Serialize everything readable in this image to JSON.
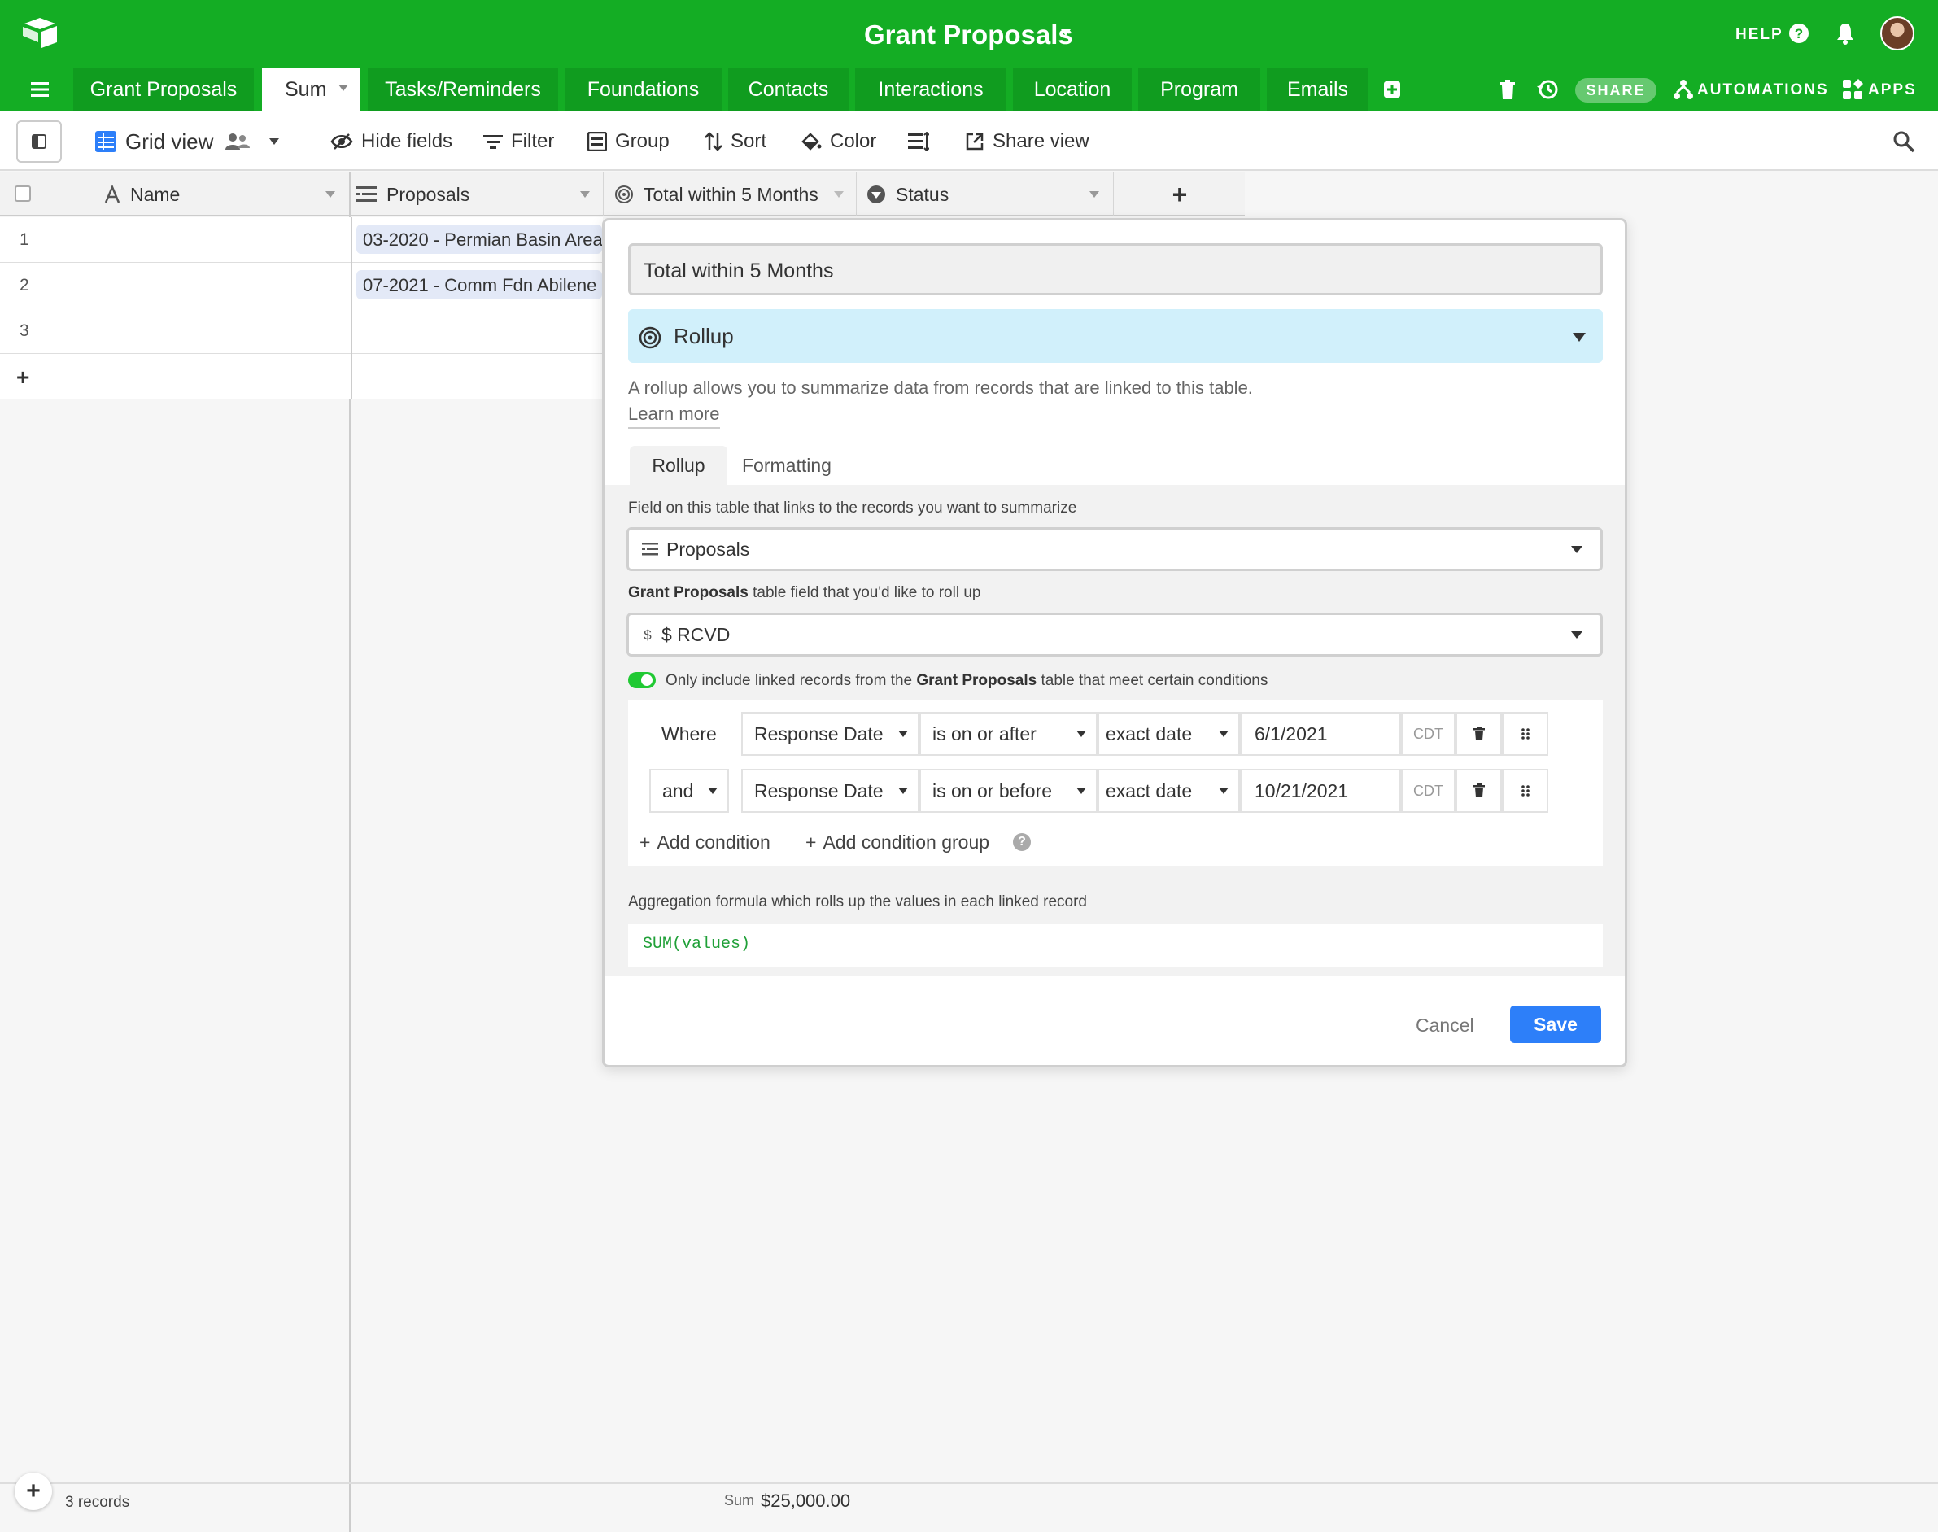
{
  "app": {
    "base_title": "Grant Proposals",
    "help_label": "HELP",
    "share_label": "SHARE",
    "automations_label": "AUTOMATIONS",
    "apps_label": "APPS",
    "accent_color": "#14ad24"
  },
  "tabs": [
    {
      "label": "Grant Proposals",
      "active": false
    },
    {
      "label": "Sum",
      "active": true
    },
    {
      "label": "Tasks/Reminders",
      "active": false
    },
    {
      "label": "Foundations",
      "active": false
    },
    {
      "label": "Contacts",
      "active": false
    },
    {
      "label": "Interactions",
      "active": false
    },
    {
      "label": "Location",
      "active": false
    },
    {
      "label": "Program",
      "active": false
    },
    {
      "label": "Emails",
      "active": false
    }
  ],
  "toolbar": {
    "view_name": "Grid view",
    "hide_fields": "Hide fields",
    "filter": "Filter",
    "group": "Group",
    "sort": "Sort",
    "color": "Color",
    "share_view": "Share view"
  },
  "grid": {
    "columns": [
      {
        "name": "Name",
        "icon": "text-icon"
      },
      {
        "name": "Proposals",
        "icon": "link-icon"
      },
      {
        "name": "Total within 5 Months",
        "icon": "rollup-icon"
      },
      {
        "name": "Status",
        "icon": "single-select-icon"
      }
    ],
    "rows": [
      {
        "number": "1",
        "proposal": "03-2020 - Permian Basin Area"
      },
      {
        "number": "2",
        "proposal": "07-2021 - Comm Fdn Abilene"
      },
      {
        "number": "3",
        "proposal": ""
      }
    ],
    "add_row_symbol": "+",
    "add_column_symbol": "+"
  },
  "footer": {
    "record_count": "3 records",
    "sum_label": "Sum",
    "sum_value": "$25,000.00"
  },
  "dialog": {
    "field_name": "Total within 5 Months",
    "field_type": "Rollup",
    "description": "A rollup allows you to summarize data from records that are linked to this table.",
    "learn_more": "Learn more",
    "tab_rollup": "Rollup",
    "tab_formatting": "Formatting",
    "link_field_label": "Field on this table that links to the records you want to summarize",
    "link_field_value": "Proposals",
    "rollup_field_label_bold": "Grant Proposals",
    "rollup_field_label_rest": " table field that you'd like to roll up",
    "rollup_field_value": "$ RCVD",
    "condition_toggle_pre": "Only include linked records from the ",
    "condition_toggle_bold": "Grant Proposals",
    "condition_toggle_post": " table that meet certain conditions",
    "conditions": [
      {
        "conjunction": "Where",
        "field": "Response Date",
        "operator": "is on or after",
        "mode": "exact date",
        "value": "6/1/2021",
        "tz": "CDT"
      },
      {
        "conjunction": "and",
        "field": "Response Date",
        "operator": "is on or before",
        "mode": "exact date",
        "value": "10/21/2021",
        "tz": "CDT"
      }
    ],
    "add_condition": "Add condition",
    "add_condition_group": "Add condition group",
    "aggregation_label": "Aggregation formula which rolls up the values in each linked record",
    "formula": "SUM(values)",
    "cancel": "Cancel",
    "save": "Save",
    "save_color": "#2d7ff9",
    "type_color": "#d1f0fb"
  }
}
